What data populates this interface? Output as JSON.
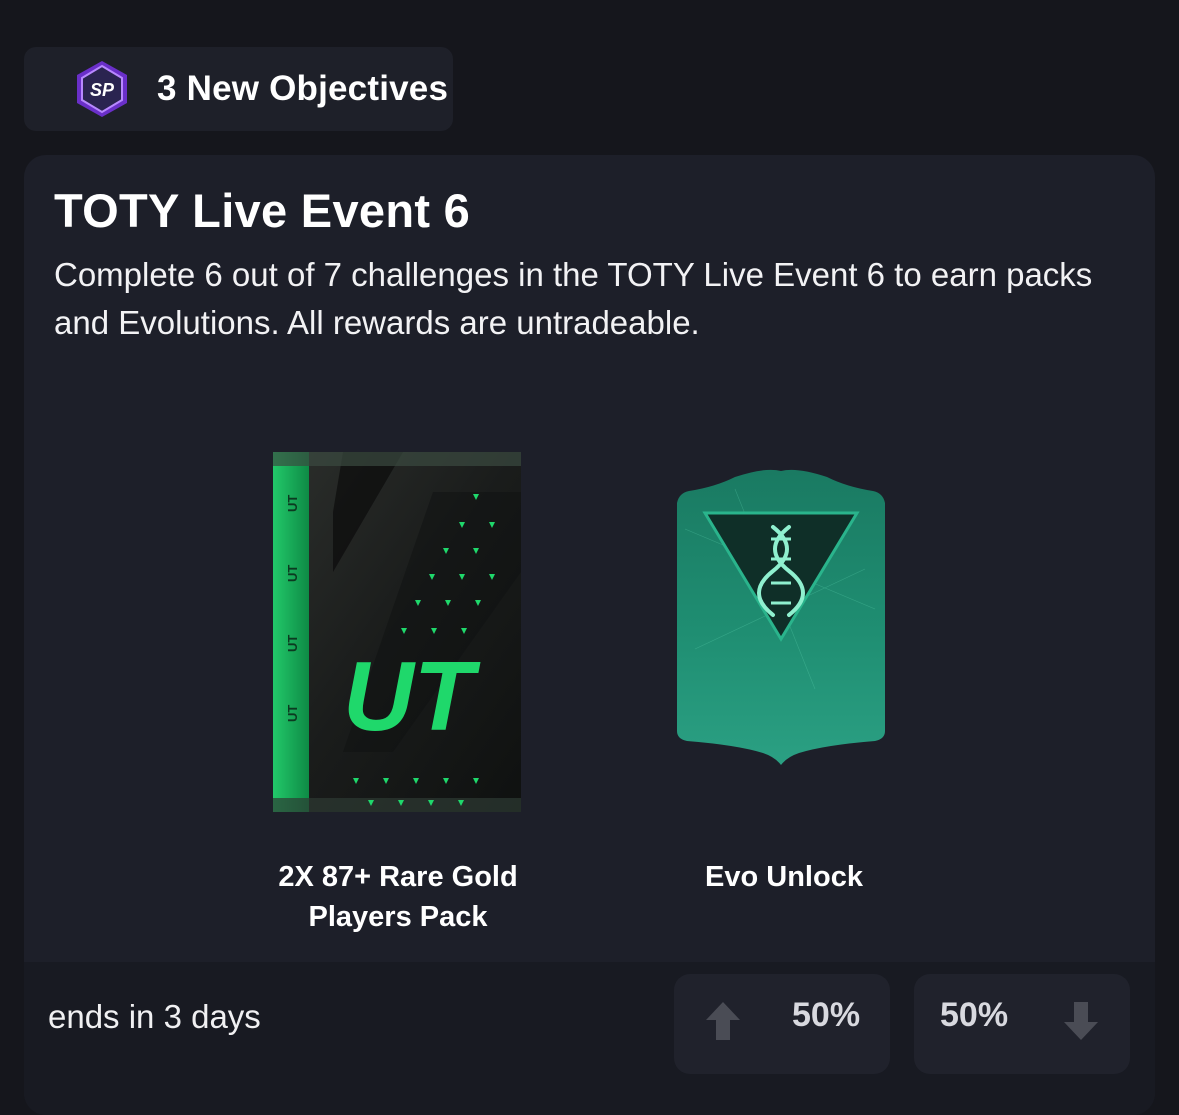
{
  "header": {
    "badge_text": "SP",
    "title": "3 New Objectives"
  },
  "event": {
    "title": "TOTY Live Event 6",
    "description": "Complete 6 out of 7 challenges in the TOTY Live Event 6 to earn packs and Evolutions. All rewards are untradeable."
  },
  "rewards": [
    {
      "label_line1": "2X 87+ Rare Gold",
      "label_line2": "Players Pack",
      "image": "ut-pack-green",
      "pack_text": "UT"
    },
    {
      "label": "Evo Unlock",
      "image": "evo-dna-card"
    }
  ],
  "footer": {
    "ends": "ends in 3 days",
    "upvote_pct": "50%",
    "downvote_pct": "50%",
    "upvote_icon": "arrow-up-icon",
    "downvote_icon": "arrow-down-icon"
  },
  "colors": {
    "background": "#15161c",
    "card": "#1d1f29",
    "accent_green": "#1fd86b",
    "evo_teal": "#1f8a6e",
    "badge_purple": "#7b3fd6"
  }
}
